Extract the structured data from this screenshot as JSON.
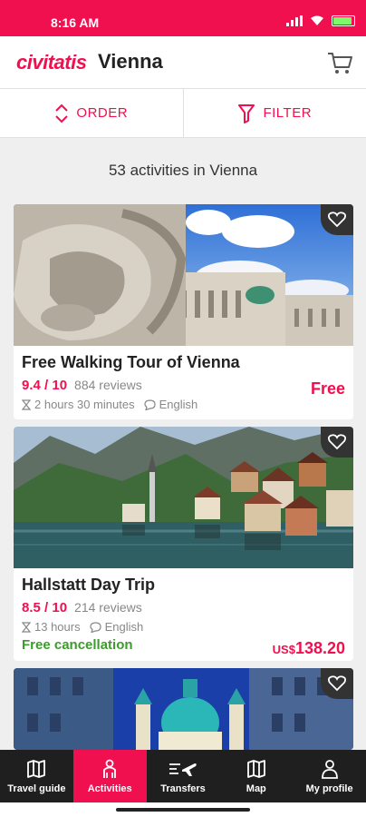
{
  "status": {
    "time": "8:16 AM",
    "battery_level": 0.9,
    "battery_text": "100"
  },
  "header": {
    "brand": "civitatis",
    "city": "Vienna",
    "cart_icon": "cart-icon"
  },
  "toolbar": {
    "order_label": "ORDER",
    "filter_label": "FILTER"
  },
  "results": {
    "count_text": "53 activities in Vienna"
  },
  "activities": [
    {
      "title": "Free Walking Tour of Vienna",
      "rating": "9.4 / 10",
      "reviews": "884 reviews",
      "duration": "2 hours 30 minutes",
      "language": "English",
      "price": "Free",
      "free_cancellation": ""
    },
    {
      "title": "Hallstatt Day Trip",
      "rating": "8.5 / 10",
      "reviews": "214 reviews",
      "duration": "13 hours",
      "language": "English",
      "price_currency": "US$",
      "price_amount": "138.20",
      "free_cancellation": "Free cancellation"
    }
  ],
  "nav": [
    {
      "label": "Travel guide",
      "icon": "book-map-icon"
    },
    {
      "label": "Activities",
      "icon": "person-icon"
    },
    {
      "label": "Transfers",
      "icon": "transfer-plane-icon"
    },
    {
      "label": "Map",
      "icon": "map-icon"
    },
    {
      "label": "My profile",
      "icon": "profile-icon"
    }
  ],
  "colors": {
    "brand": "#f0104f",
    "nav_bg": "#1f1f1f",
    "success": "#3d9a2e"
  }
}
